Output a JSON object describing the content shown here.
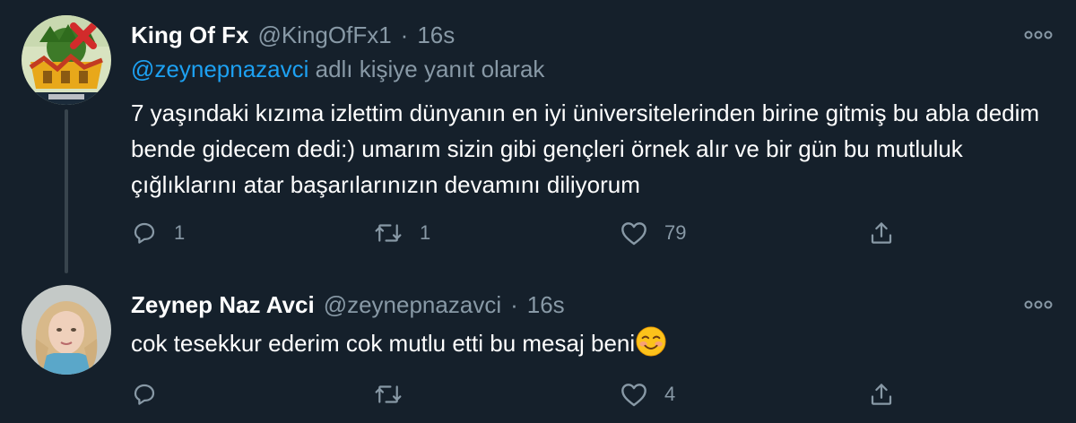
{
  "colors": {
    "background": "#15202b",
    "text_primary": "#ffffff",
    "text_secondary": "#8899a6",
    "link": "#1da1f2",
    "thread_line": "#38444d"
  },
  "tweets": [
    {
      "display_name": "King Of Fx",
      "handle": "@KingOfFx1",
      "separator": "·",
      "time": "16s",
      "reply_context": {
        "mention": "@zeynepnazavci",
        "suffix": " adlı kişiye yanıt olarak"
      },
      "text": "7 yaşındaki kızıma izlettim dünyanın en iyi üniversitelerinden birine gitmiş bu abla dedim bende gidecem dedi:) umarım sizin gibi gençleri örnek alır ve bir gün bu mutluluk çığlıklarını atar başarılarınızın devamını diliyorum",
      "actions": {
        "reply_count": "1",
        "retweet_count": "1",
        "like_count": "79"
      },
      "icons": {
        "more": "more-horizontal-icon",
        "reply": "reply-icon",
        "retweet": "retweet-icon",
        "like": "heart-icon",
        "share": "share-icon"
      }
    },
    {
      "display_name": "Zeynep Naz Avci",
      "handle": "@zeynepnazavci",
      "separator": "·",
      "time": "16s",
      "text": "cok tesekkur ederim cok mutlu etti bu mesaj beni",
      "text_emoji": "smiling-face-with-blush-emoji",
      "actions": {
        "reply_count": "",
        "retweet_count": "",
        "like_count": "4"
      },
      "icons": {
        "more": "more-horizontal-icon",
        "reply": "reply-icon",
        "retweet": "retweet-icon",
        "like": "heart-icon",
        "share": "share-icon"
      }
    }
  ]
}
